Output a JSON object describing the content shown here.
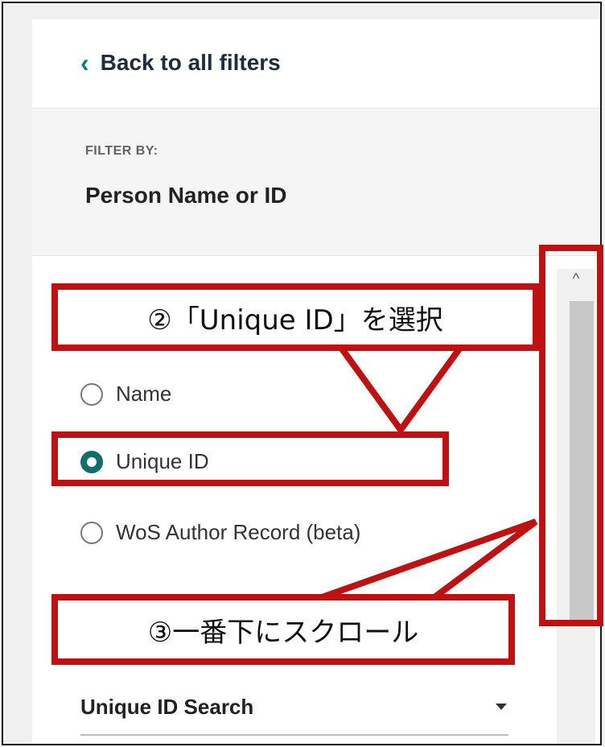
{
  "back": {
    "label": "Back to all filters"
  },
  "filter": {
    "heading": "FILTER BY:",
    "title": "Person Name or ID"
  },
  "options": [
    {
      "label": "Name",
      "checked": false
    },
    {
      "label": "Unique ID",
      "checked": true
    },
    {
      "label": "WoS Author Record (beta)",
      "checked": false
    }
  ],
  "search_select": {
    "value": "Unique ID Search"
  },
  "annotations": {
    "step2": "②「Unique ID」を選択",
    "step3": "③一番下にスクロール"
  },
  "colors": {
    "accent": "#116e6a",
    "annotation": "#bf1111"
  }
}
